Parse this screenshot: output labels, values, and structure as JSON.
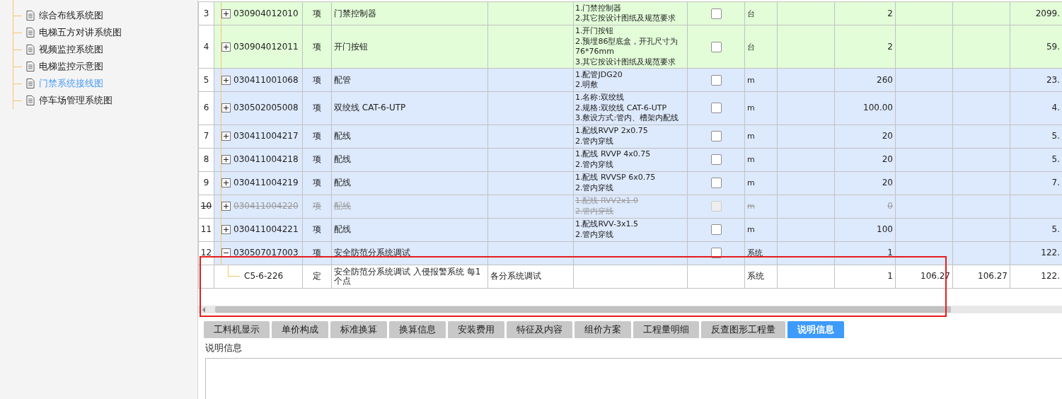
{
  "sidebar": {
    "items": [
      {
        "label": "综合布线系统图",
        "selected": false
      },
      {
        "label": "电梯五方对讲系统图",
        "selected": false
      },
      {
        "label": "视频监控系统图",
        "selected": false
      },
      {
        "label": "电梯监控示意图",
        "selected": false
      },
      {
        "label": "门禁系统接线图",
        "selected": true
      },
      {
        "label": "停车场管理系统图",
        "selected": false
      }
    ]
  },
  "table": {
    "rows": [
      {
        "kind": "item",
        "color": "#e2fdd8",
        "number": "3",
        "expanded": false,
        "deleted": false,
        "code": "030904012010",
        "type": "项",
        "name": "门禁控制器",
        "description": "1.门禁控制器\n2.其它按设计图纸及规范要求",
        "checked": false,
        "unit": "台",
        "quantity": "2",
        "total": "2099."
      },
      {
        "kind": "item",
        "color": "#e2fdd8",
        "number": "4",
        "expanded": false,
        "deleted": false,
        "code": "030904012011",
        "type": "项",
        "name": "开门按钮",
        "description": "1.开门按钮\n2.预埋86型底盒，开孔尺寸为76*76mm\n3.其它按设计图纸及规范要求",
        "checked": false,
        "unit": "台",
        "quantity": "2",
        "total": "59."
      },
      {
        "kind": "item",
        "color": "#dde9fc",
        "number": "5",
        "expanded": false,
        "deleted": false,
        "code": "030411001068",
        "type": "项",
        "name": "配管",
        "description": "1.配管JDG20\n2.明敷",
        "checked": false,
        "unit": "m",
        "quantity": "260",
        "total": "23."
      },
      {
        "kind": "item",
        "color": "#dde9fc",
        "number": "6",
        "expanded": false,
        "deleted": false,
        "code": "030502005008",
        "type": "项",
        "name": "双绞线 CAT-6-UTP",
        "description": "1.名称:双绞线\n2.规格:双绞线 CAT-6-UTP\n3.敷设方式:管内、槽架内配线",
        "checked": false,
        "unit": "m",
        "quantity": "100.00",
        "total": "4."
      },
      {
        "kind": "item",
        "color": "#dde9fc",
        "number": "7",
        "expanded": false,
        "deleted": false,
        "code": "030411004217",
        "type": "项",
        "name": "配线",
        "description": "1.配线RVVP 2x0.75\n2.管内穿线",
        "checked": false,
        "unit": "m",
        "quantity": "20",
        "total": "5."
      },
      {
        "kind": "item",
        "color": "#dde9fc",
        "number": "8",
        "expanded": false,
        "deleted": false,
        "code": "030411004218",
        "type": "项",
        "name": "配线",
        "description": "1.配线 RVVP 4x0.75\n2.管内穿线",
        "checked": false,
        "unit": "m",
        "quantity": "20",
        "total": "5."
      },
      {
        "kind": "item",
        "color": "#dde9fc",
        "number": "9",
        "expanded": false,
        "deleted": false,
        "code": "030411004219",
        "type": "项",
        "name": "配线",
        "description": "1.配线 RVVSP 6x0.75\n2.管内穿线",
        "checked": false,
        "unit": "m",
        "quantity": "20",
        "total": "7."
      },
      {
        "kind": "item",
        "color": "#dde9fc",
        "number": "10",
        "expanded": false,
        "deleted": true,
        "code": "030411004220",
        "type": "项",
        "name": "配线",
        "description": "1.配线 RVV2x1.0\n2.管内穿线",
        "checked": false,
        "unit": "m",
        "quantity": "0"
      },
      {
        "kind": "item",
        "color": "#dde9fc",
        "number": "11",
        "expanded": false,
        "deleted": false,
        "code": "030411004221",
        "type": "项",
        "name": "配线",
        "description": "1.配线RVV-3x1.5\n2.管内穿线",
        "checked": false,
        "unit": "m",
        "quantity": "100",
        "total": "5."
      },
      {
        "kind": "item",
        "color": "#dde9fc",
        "number": "12",
        "expanded": true,
        "deleted": false,
        "code": "030507017003",
        "type": "项",
        "name": "安全防范分系统调试",
        "checked": false,
        "unit": "系统",
        "quantity": "1",
        "total": "122."
      },
      {
        "kind": "quota",
        "code": "C5-6-226",
        "type": "定",
        "name": "安全防范分系统调试 入侵报警系统 每1个点",
        "feature": "各分系统调试",
        "unit": "系统",
        "quantity": "1",
        "price_1": "106.27",
        "price_2": "106.27",
        "total": "122."
      }
    ]
  },
  "tabs": [
    {
      "label": "工料机显示",
      "selected": false
    },
    {
      "label": "单价构成",
      "selected": false
    },
    {
      "label": "标准换算",
      "selected": false
    },
    {
      "label": "换算信息",
      "selected": false
    },
    {
      "label": "安装费用",
      "selected": false
    },
    {
      "label": "特征及内容",
      "selected": false
    },
    {
      "label": "组价方案",
      "selected": false
    },
    {
      "label": "工程量明细",
      "selected": false
    },
    {
      "label": "反查图形工程量",
      "selected": false
    },
    {
      "label": "说明信息",
      "selected": true
    }
  ],
  "panel": {
    "label": "说明信息"
  }
}
